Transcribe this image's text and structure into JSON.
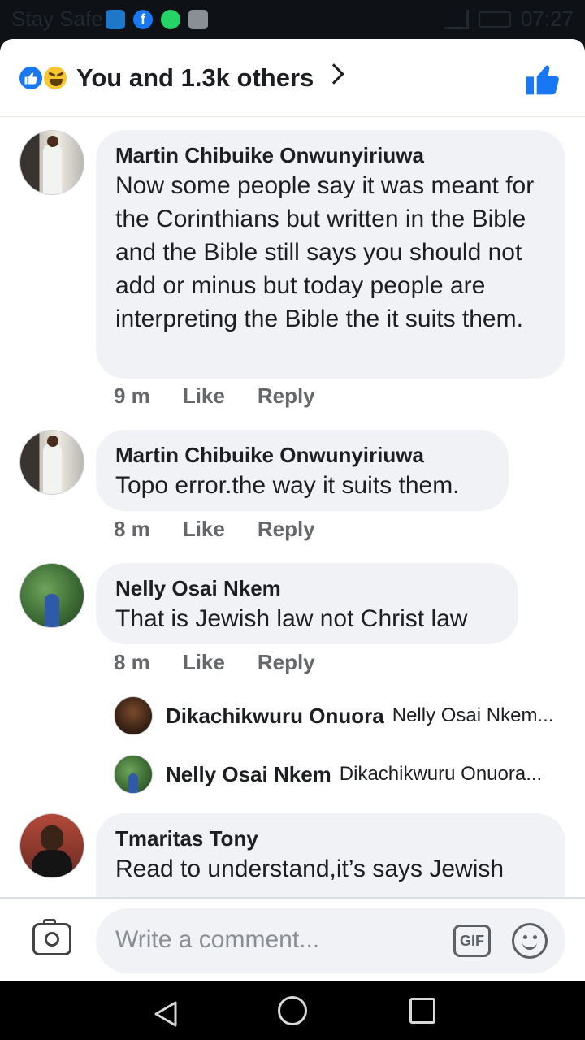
{
  "status_bar": {
    "carrier_text": "Stay Safe",
    "time": "07:27",
    "icons": [
      "app-icon",
      "facebook-icon",
      "whatsapp-icon",
      "gallery-icon",
      "signal-icon",
      "battery-icon"
    ]
  },
  "reactions": {
    "summary": "You and 1.3k others",
    "icons": [
      "like-reaction-icon",
      "haha-reaction-icon",
      "chevron-right-icon",
      "thumbs-up-icon"
    ],
    "accent_color": "#1877f2"
  },
  "comments": [
    {
      "author": "Martin Chibuike Onwunyiriuwa",
      "text": "Now some people say it was meant for the Corinthians but written in the Bible and the Bible still says you should not add or minus but today people are interpreting the Bible the it suits them.",
      "time": "9 m",
      "like": "Like",
      "reply": "Reply"
    },
    {
      "author": "Martin Chibuike Onwunyiriuwa",
      "text": "Topo error.the way it suits them.",
      "time": "8 m",
      "like": "Like",
      "reply": "Reply"
    },
    {
      "author": "Nelly Osai Nkem",
      "text": "That is Jewish law not Christ law",
      "time": "8 m",
      "like": "Like",
      "reply": "Reply",
      "replies": [
        {
          "author": "Dikachikwuru Onuora",
          "preview": "Nelly Osai Nkem..."
        },
        {
          "author": "Nelly Osai Nkem",
          "preview": "Dikachikwuru Onuora..."
        }
      ]
    },
    {
      "author": "Tmaritas Tony",
      "text": "Read to understand,it’s says Jewish"
    }
  ],
  "composer": {
    "placeholder": "Write a comment...",
    "gif_label": "GIF"
  }
}
